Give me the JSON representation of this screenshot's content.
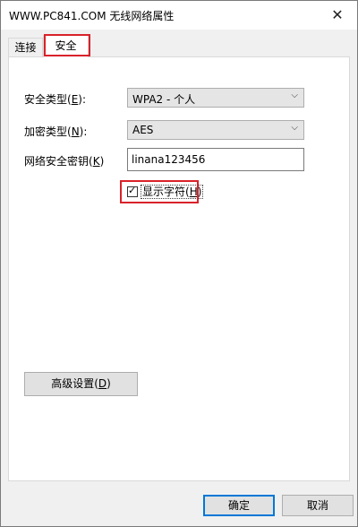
{
  "window": {
    "title": "WWW.PC841.COM 无线网络属性",
    "close_glyph": "✕"
  },
  "tabs": [
    {
      "label": "连接",
      "selected": false
    },
    {
      "label": "安全",
      "selected": true
    }
  ],
  "security": {
    "type_label_prefix": "安全类型(",
    "type_label_key": "E",
    "type_label_suffix": "):",
    "type_value": "WPA2 - 个人",
    "encryption_label_prefix": "加密类型(",
    "encryption_label_key": "N",
    "encryption_label_suffix": "):",
    "encryption_value": "AES",
    "key_label_prefix": "网络安全密钥(",
    "key_label_key": "K",
    "key_label_suffix": ")",
    "key_value": "linana123456",
    "show_chars_label_prefix": "显示字符(",
    "show_chars_label_key": "H",
    "show_chars_label_suffix": ")",
    "show_chars_checked": true,
    "advanced_label_prefix": "高级设置(",
    "advanced_label_key": "D",
    "advanced_label_suffix": ")"
  },
  "footer": {
    "ok_label": "确定",
    "cancel_label": "取消"
  },
  "icons": {
    "chevron": "⌵",
    "check": "✓"
  },
  "colors": {
    "highlight": "#d9222a",
    "default_button_border": "#0078d7"
  }
}
